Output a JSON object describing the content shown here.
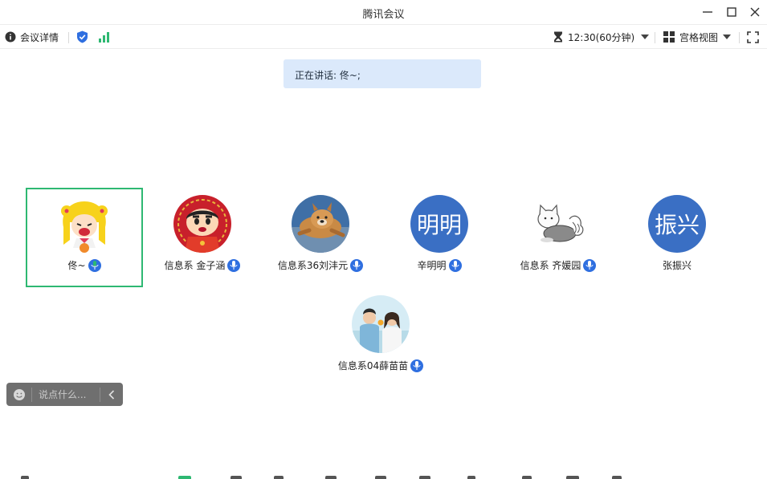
{
  "window": {
    "title": "腾讯会议"
  },
  "toolbar": {
    "meeting_info_label": "会议详情",
    "timer_label": "12:30(60分钟)",
    "view_label": "宫格视图"
  },
  "speaking": {
    "text": "正在讲话: 佟~;"
  },
  "participants": [
    {
      "name": "佟~",
      "avatar_type": "sailor-moon-cartoon",
      "mic": "speaking"
    },
    {
      "name": "信息系 金子涵",
      "avatar_type": "crayon-shinchan-cartoon",
      "mic": "on"
    },
    {
      "name": "信息系36刘沣元",
      "avatar_type": "dog-photo",
      "mic": "on"
    },
    {
      "name": "辛明明",
      "avatar_text": "明明",
      "mic": "on"
    },
    {
      "name": "信息系 齐媛园",
      "avatar_type": "cat-drawing",
      "mic": "on"
    },
    {
      "name": "张振兴",
      "avatar_text": "振兴",
      "mic": "none"
    },
    {
      "name": "信息系04薛苗苗",
      "avatar_type": "couple-photo",
      "mic": "on"
    }
  ],
  "chat": {
    "placeholder": "说点什么..."
  },
  "colors": {
    "accent_blue": "#2f6fe0",
    "active_border": "#2eb872",
    "avatar_bg": "#3a6fc4",
    "banner_bg": "#dbe9fb"
  }
}
